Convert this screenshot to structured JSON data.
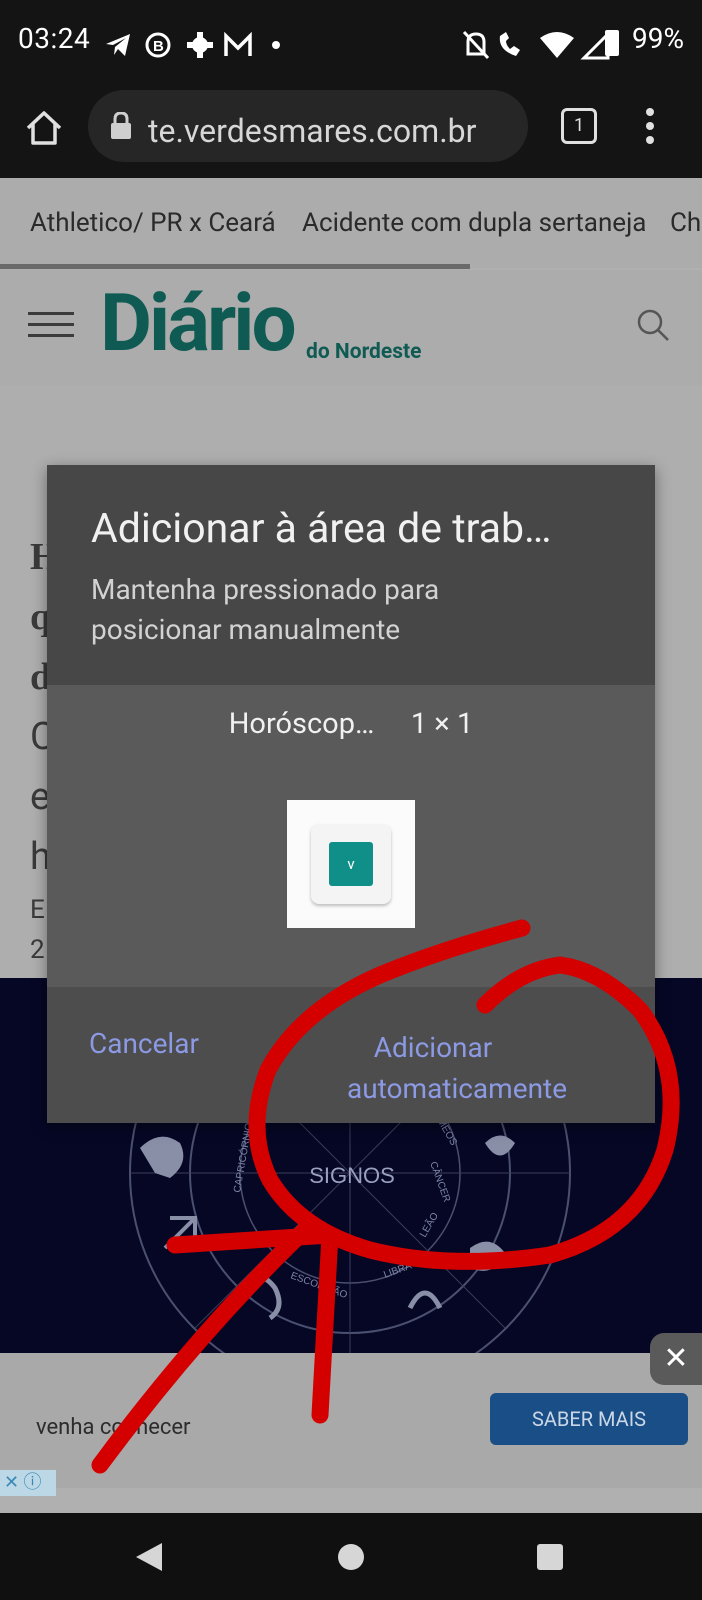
{
  "status_bar": {
    "time": "03:24",
    "battery": "99%",
    "left_icons": [
      "telegram-icon",
      "b-icon",
      "settings-icon",
      "mail-icon",
      "dot-icon"
    ],
    "right_icons": [
      "mute-icon",
      "wifi-call-icon",
      "wifi-icon",
      "signal-icon",
      "battery-icon"
    ]
  },
  "browser": {
    "url": "te.verdesmares.com.br",
    "tab_count": "1"
  },
  "page": {
    "nav_links": [
      "Athletico/ PR x Ceará",
      "Acidente com dupla sertaneja",
      "Ch"
    ],
    "logo_text": "Diário",
    "logo_sub": "do Nordeste",
    "article_fragments": [
      "H",
      "q",
      "d",
      "C",
      "e",
      "h",
      "E",
      "2"
    ],
    "banner_label": "SIGNOS",
    "banner_zodiac": [
      "CAPRICÓRNIO",
      "CÂNCER",
      "ESCORPIÃO",
      "LIBRA",
      "LEÃO",
      "GÊMEOS"
    ],
    "ad_text": "venha conhecer",
    "ad_button": "SABER MAIS",
    "ad_close": "✕"
  },
  "dialog": {
    "title": "Adicionar à área de trab…",
    "subtitle": "Mantenha pressionado para posicionar manualmente",
    "widget_name": "Horóscop…",
    "widget_size": "1 × 1",
    "widget_icon_letter": "v",
    "cancel_label": "Cancelar",
    "add_label": "Adicionar automaticamente"
  },
  "colors": {
    "accent_button_text": "#8c99e3",
    "logo_teal": "#0f5b54",
    "annotation_red": "#d40000"
  }
}
